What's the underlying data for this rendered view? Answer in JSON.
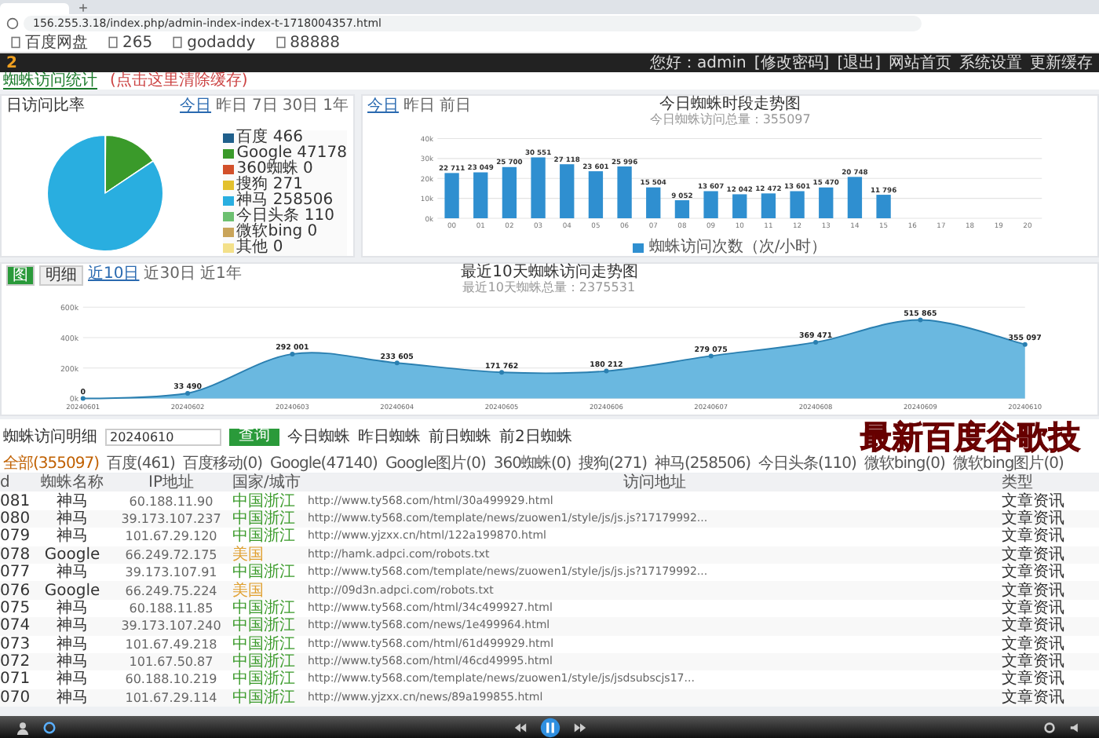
{
  "browser": {
    "url": "156.255.3.18/index.php/admin-index-index-t-1718004357.html",
    "bookmarks": [
      "百度网盘",
      "265",
      "godaddy",
      "88888"
    ]
  },
  "header": {
    "logo": "2",
    "greeting": "您好：admin",
    "links": [
      "[修改密码]",
      "[退出]"
    ],
    "actions": [
      "网站首页",
      "系统设置",
      "更新缓存"
    ]
  },
  "tabs": [
    {
      "label": "蜘蛛访问统计",
      "selected": true
    },
    {
      "label": "(点击这里清除缓存)",
      "selected": false
    }
  ],
  "pie_panel": {
    "title": "日访问比率",
    "ranges": [
      {
        "label": "今日",
        "selected": true
      },
      {
        "label": "昨日",
        "selected": false
      },
      {
        "label": "7日",
        "selected": false
      },
      {
        "label": "30日",
        "selected": false
      },
      {
        "label": "1年",
        "selected": false
      }
    ],
    "legend": [
      {
        "name": "百度",
        "count": "466",
        "color": "#1f5f8b"
      },
      {
        "name": "Google",
        "count": "47178",
        "color": "#3a9a2a"
      },
      {
        "name": "360蜘蛛",
        "count": "0",
        "color": "#d2502a"
      },
      {
        "name": "搜狗",
        "count": "271",
        "color": "#e3c12e"
      },
      {
        "name": "神马",
        "count": "258506",
        "color": "#29aee0"
      },
      {
        "name": "今日头条",
        "count": "110",
        "color": "#6cc070"
      },
      {
        "name": "微软bing",
        "count": "0",
        "color": "#c9a45a"
      },
      {
        "name": "其他",
        "count": "0",
        "color": "#f3e08a"
      }
    ]
  },
  "bar_panel": {
    "ranges": [
      {
        "label": "今日",
        "selected": true
      },
      {
        "label": "昨日",
        "selected": false
      },
      {
        "label": "前日",
        "selected": false
      }
    ],
    "chart_data": {
      "type": "bar",
      "title": "今日蜘蛛时段走势图",
      "subtitle": "今日蜘蛛访问总量：355097",
      "categories": [
        "00",
        "01",
        "02",
        "03",
        "04",
        "05",
        "06",
        "07",
        "08",
        "09",
        "10",
        "11",
        "12",
        "13",
        "14",
        "15",
        "16",
        "17",
        "18",
        "19",
        "20"
      ],
      "series": [
        {
          "name": "蜘蛛访问次数（次/小时）",
          "color": "#2f8fd0",
          "values": [
            22711,
            23049,
            25700,
            30551,
            27118,
            23601,
            25996,
            15504,
            9052,
            13607,
            12042,
            12472,
            13601,
            15470,
            20748,
            11796,
            null,
            null,
            null,
            null,
            null
          ]
        }
      ],
      "ylim": [
        0,
        40000
      ],
      "yticks": [
        {
          "value": 0,
          "label": "0k"
        },
        {
          "value": 10000,
          "label": "10k"
        },
        {
          "value": 20000,
          "label": "20k"
        },
        {
          "value": 30000,
          "label": "30k"
        },
        {
          "value": 40000,
          "label": "40k"
        }
      ],
      "grid": true,
      "data_labels": true
    }
  },
  "area_panel": {
    "views": [
      {
        "label": "图",
        "selected": true
      },
      {
        "label": "明细",
        "selected": false
      }
    ],
    "ranges": [
      {
        "label": "近10日",
        "selected": true
      },
      {
        "label": "近30日",
        "selected": false
      },
      {
        "label": "近1年",
        "selected": false
      }
    ],
    "chart_data": {
      "type": "area",
      "title": "最近10天蜘蛛访问走势图",
      "subtitle": "最近10天蜘蛛总量：2375531",
      "categories": [
        "20240601",
        "20240602",
        "20240603",
        "20240604",
        "20240605",
        "20240606",
        "20240607",
        "20240608",
        "20240609",
        "20240610"
      ],
      "series": [
        {
          "color": "#6ab8e0",
          "values": [
            0,
            33490,
            292001,
            233605,
            171762,
            180212,
            279075,
            369471,
            515865,
            355097
          ]
        }
      ],
      "ylim": [
        0,
        600000
      ],
      "yticks": [
        {
          "value": 0,
          "label": "0k"
        },
        {
          "value": 200000,
          "label": "200k"
        },
        {
          "value": 400000,
          "label": "400k"
        },
        {
          "value": 600000,
          "label": "600k"
        }
      ],
      "grid": true,
      "data_labels": true
    }
  },
  "detail": {
    "label": "蜘蛛访问明细",
    "date": "20240610",
    "search_button": "查询",
    "quick": [
      "今日蜘蛛",
      "昨日蜘蛛",
      "前日蜘蛛",
      "前2日蜘蛛"
    ],
    "spiders": [
      {
        "label": "全部(355097)",
        "selected": true
      },
      {
        "label": "百度(461)",
        "selected": false
      },
      {
        "label": "百度移动(0)",
        "selected": false
      },
      {
        "label": "Google(47140)",
        "selected": false
      },
      {
        "label": "Google图片(0)",
        "selected": false
      },
      {
        "label": "360蜘蛛(0)",
        "selected": false
      },
      {
        "label": "搜狗(271)",
        "selected": false
      },
      {
        "label": "神马(258506)",
        "selected": false
      },
      {
        "label": "今日头条(110)",
        "selected": false
      },
      {
        "label": "微软bing(0)",
        "selected": false
      },
      {
        "label": "微软bing图片(0)",
        "selected": false
      }
    ]
  },
  "overlay_caption": "最新百度谷歌技",
  "table": {
    "columns": [
      "d",
      "蜘蛛名称",
      "IP地址",
      "国家/城市",
      "访问地址",
      "类型"
    ],
    "rows": [
      {
        "id": "081",
        "spider": "神马",
        "ip": "60.188.11.90",
        "region": "中国浙江",
        "color": "#3a9a2a",
        "url": "http://www.ty568.com/html/30a499929.html",
        "type": "文章资讯"
      },
      {
        "id": "080",
        "spider": "神马",
        "ip": "39.173.107.237",
        "region": "中国浙江",
        "color": "#3a9a2a",
        "url": "http://www.ty568.com/template/news/zuowen1/style/js/js.js?17179992...",
        "type": "文章资讯"
      },
      {
        "id": "079",
        "spider": "神马",
        "ip": "101.67.29.120",
        "region": "中国浙江",
        "color": "#3a9a2a",
        "url": "http://www.yjzxx.cn/html/122a199870.html",
        "type": "文章资讯"
      },
      {
        "id": "078",
        "spider": "Google",
        "ip": "66.249.72.175",
        "region": "美国",
        "color": "#e0a030",
        "url": "http://hamk.adpci.com/robots.txt",
        "type": "文章资讯"
      },
      {
        "id": "077",
        "spider": "神马",
        "ip": "39.173.107.91",
        "region": "中国浙江",
        "color": "#3a9a2a",
        "url": "http://www.ty568.com/template/news/zuowen1/style/js/js.js?17179992...",
        "type": "文章资讯"
      },
      {
        "id": "076",
        "spider": "Google",
        "ip": "66.249.75.224",
        "region": "美国",
        "color": "#e0a030",
        "url": "http://09d3n.adpci.com/robots.txt",
        "type": "文章资讯"
      },
      {
        "id": "075",
        "spider": "神马",
        "ip": "60.188.11.85",
        "region": "中国浙江",
        "color": "#3a9a2a",
        "url": "http://www.ty568.com/html/34c499927.html",
        "type": "文章资讯"
      },
      {
        "id": "074",
        "spider": "神马",
        "ip": "39.173.107.240",
        "region": "中国浙江",
        "color": "#3a9a2a",
        "url": "http://www.ty568.com/news/1e499964.html",
        "type": "文章资讯"
      },
      {
        "id": "073",
        "spider": "神马",
        "ip": "101.67.49.218",
        "region": "中国浙江",
        "color": "#3a9a2a",
        "url": "http://www.ty568.com/html/61d499929.html",
        "type": "文章资讯"
      },
      {
        "id": "072",
        "spider": "神马",
        "ip": "101.67.50.87",
        "region": "中国浙江",
        "color": "#3a9a2a",
        "url": "http://www.ty568.com/html/46cd49995.html",
        "type": "文章资讯"
      },
      {
        "id": "071",
        "spider": "神马",
        "ip": "60.188.10.219",
        "region": "中国浙江",
        "color": "#3a9a2a",
        "url": "http://www.ty568.com/template/news/zuowen1/style/js/jsdsubscjs17...",
        "type": "文章资讯"
      },
      {
        "id": "070",
        "spider": "神马",
        "ip": "101.67.29.114",
        "region": "中国浙江",
        "color": "#3a9a2a",
        "url": "http://www.yjzxx.cn/news/89a199855.html",
        "type": "文章资讯"
      }
    ]
  }
}
